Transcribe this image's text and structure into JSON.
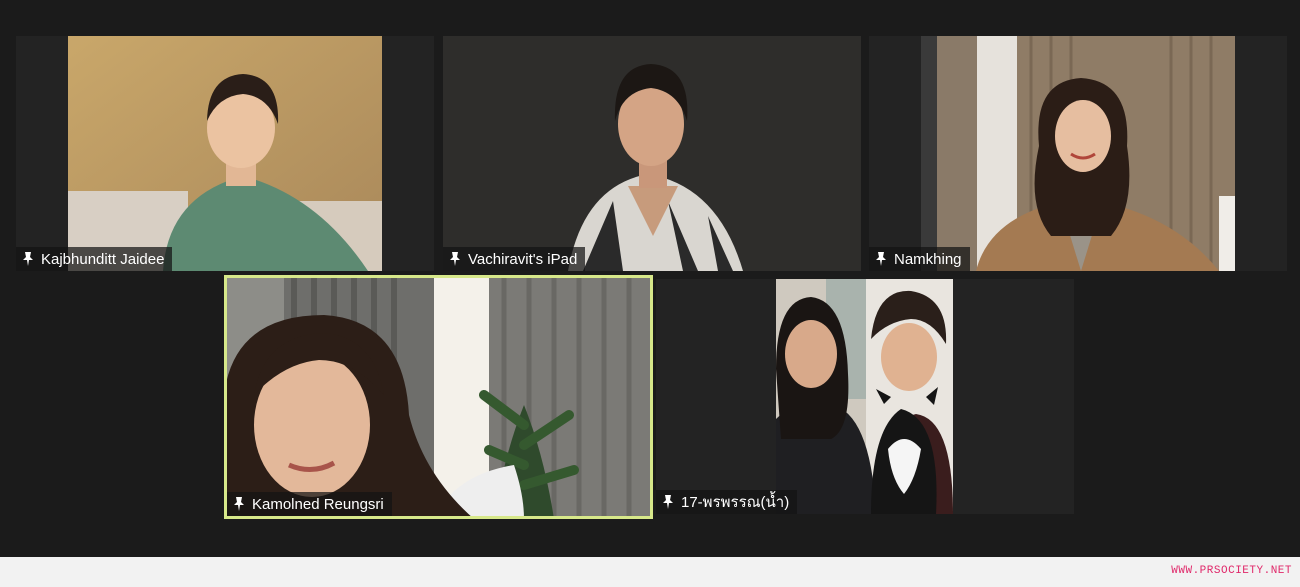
{
  "participants": [
    {
      "name": "Kajbhunditt Jaidee",
      "pinned": true,
      "active_speaker": false
    },
    {
      "name": "Vachiravit's iPad",
      "pinned": true,
      "active_speaker": false
    },
    {
      "name": "Namkhing",
      "pinned": true,
      "active_speaker": false
    },
    {
      "name": "Kamolned Reungsri",
      "pinned": true,
      "active_speaker": true
    },
    {
      "name": "17-พรพรรณ(น้ำ)",
      "pinned": true,
      "active_speaker": false
    }
  ],
  "watermark": "WWW.PRSOCIETY.NET",
  "colors": {
    "active_speaker_border": "#d7e88a",
    "watermark": "#e0286a",
    "background": "#1b1b1b"
  }
}
